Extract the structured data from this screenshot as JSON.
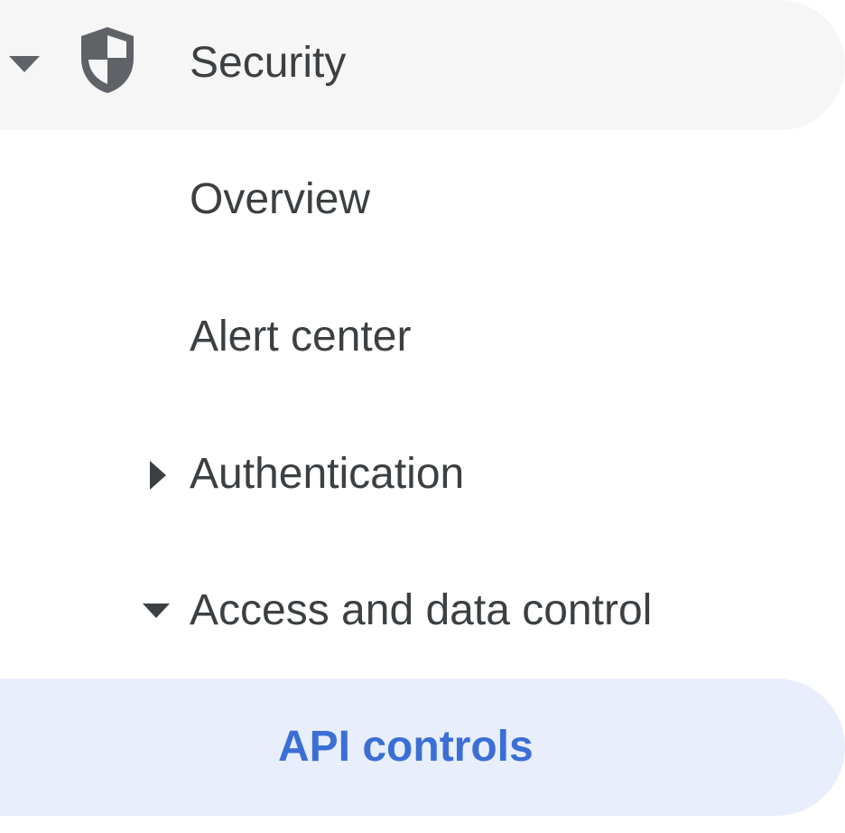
{
  "nav": {
    "section": {
      "label": "Security",
      "icon": "shield-icon",
      "expanded": true
    },
    "items": [
      {
        "label": "Overview"
      },
      {
        "label": "Alert center"
      },
      {
        "label": "Authentication",
        "expanded": false
      },
      {
        "label": "Access and data control",
        "expanded": true
      },
      {
        "label": "API controls",
        "selected": true
      }
    ]
  },
  "colors": {
    "header_bg": "#f6f6f6",
    "selected_bg": "#e8eefc",
    "selected_text": "#3b6fd6",
    "text": "#3c4043",
    "icon": "#5f6368"
  }
}
